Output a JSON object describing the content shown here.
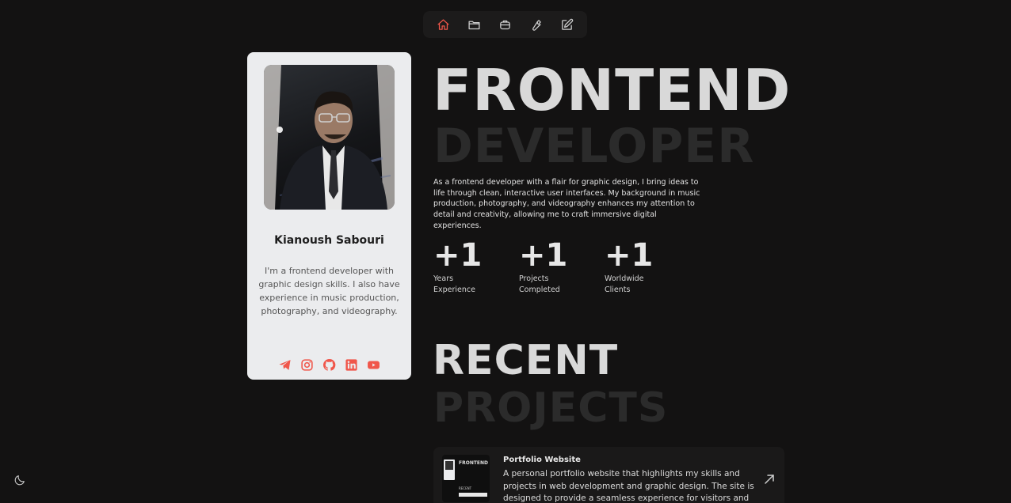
{
  "nav": {
    "items": [
      {
        "icon": "home-icon",
        "active": true
      },
      {
        "icon": "folder-icon",
        "active": false
      },
      {
        "icon": "briefcase-icon",
        "active": false
      },
      {
        "icon": "wrench-icon",
        "active": false
      },
      {
        "icon": "edit-icon",
        "active": false
      }
    ],
    "active_color": "#f0564a"
  },
  "profile": {
    "name": "Kianoush Sabouri",
    "bio": "I'm a frontend developer with graphic design skills. I also have experience in music production, photography, and videography.",
    "socials": [
      "telegram-icon",
      "instagram-icon",
      "github-icon",
      "linkedin-icon",
      "youtube-icon"
    ],
    "social_color": "#f0564a"
  },
  "hero": {
    "title_line1": "FRONTEND",
    "title_line2": "DEVELOPER",
    "description": "As a frontend developer with a flair for graphic design, I bring ideas to life through clean, interactive user interfaces. My background in music production, photography, and videography enhances my attention to detail and creativity, allowing me to craft immersive digital experiences."
  },
  "stats": [
    {
      "value": "+1",
      "label": "Years Experience"
    },
    {
      "value": "+1",
      "label": "Projects Completed"
    },
    {
      "value": "+1",
      "label": "Worldwide Clients"
    }
  ],
  "recent": {
    "title_line1": "RECENT",
    "title_line2": "PROJECTS"
  },
  "projects": [
    {
      "title": "Portfolio Website",
      "description": "A personal portfolio website that highlights my skills and projects in web development and graphic design. The site is designed to provide a seamless experience for visitors and potential clients.",
      "thumb_title": "FRONTEND",
      "thumb_sub": "RECENT"
    }
  ],
  "theme_toggle_icon": "moon-icon"
}
